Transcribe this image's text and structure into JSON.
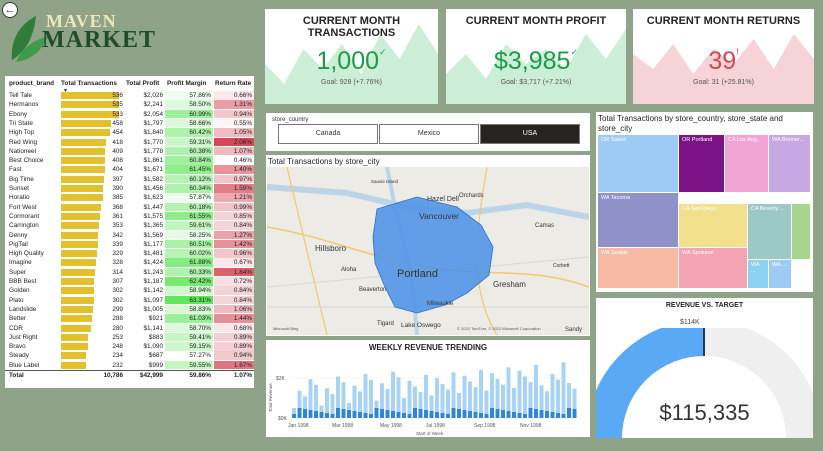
{
  "logo": {
    "line1": "MAVEN",
    "line2": "MARKET"
  },
  "table": {
    "headers": {
      "brand": "product_brand",
      "tx": "Total Transactions",
      "profit": "Total Profit",
      "margin": "Profit Margin",
      "return": "Return Rate"
    },
    "rows": [
      [
        "Tell Tale",
        "536",
        "$2,026",
        "57.86%",
        "0.66%"
      ],
      [
        "Hermanos",
        "535",
        "$2,241",
        "58.50%",
        "1.31%"
      ],
      [
        "Ebony",
        "533",
        "$2,054",
        "60.99%",
        "0.94%"
      ],
      [
        "Tri State",
        "458",
        "$1,797",
        "58.66%",
        "0.55%"
      ],
      [
        "High Top",
        "454",
        "$1,840",
        "60.42%",
        "1.05%"
      ],
      [
        "Red Wing",
        "418",
        "$1,770",
        "59.31%",
        "2.06%"
      ],
      [
        "Nationeel",
        "409",
        "$1,778",
        "60.38%",
        "1.07%"
      ],
      [
        "Best Choice",
        "408",
        "$1,861",
        "60.84%",
        "0.46%"
      ],
      [
        "Fast",
        "404",
        "$1,671",
        "61.45%",
        "1.40%"
      ],
      [
        "Big Time",
        "397",
        "$1,582",
        "60.12%",
        "0.97%"
      ],
      [
        "Sunset",
        "390",
        "$1,456",
        "60.34%",
        "1.59%"
      ],
      [
        "Horatio",
        "385",
        "$1,623",
        "57.87%",
        "1.21%"
      ],
      [
        "Fort West",
        "368",
        "$1,447",
        "60.18%",
        "0.99%"
      ],
      [
        "Cormorant",
        "361",
        "$1,575",
        "61.55%",
        "0.85%"
      ],
      [
        "Carrington",
        "353",
        "$1,365",
        "59.61%",
        "0.84%"
      ],
      [
        "Denny",
        "342",
        "$1,569",
        "58.25%",
        "1.27%"
      ],
      [
        "PigTail",
        "339",
        "$1,177",
        "60.51%",
        "1.42%"
      ],
      [
        "High Quality",
        "329",
        "$1,481",
        "60.02%",
        "0.96%"
      ],
      [
        "Imagine",
        "328",
        "$1,424",
        "61.88%",
        "0.67%"
      ],
      [
        "Super",
        "314",
        "$1,243",
        "60.33%",
        "1.84%"
      ],
      [
        "BBB Best",
        "307",
        "$1,187",
        "62.42%",
        "0.72%"
      ],
      [
        "Golden",
        "302",
        "$1,142",
        "58.94%",
        "0.84%"
      ],
      [
        "Plato",
        "302",
        "$1,097",
        "63.31%",
        "0.84%"
      ],
      [
        "Landslide",
        "299",
        "$1,005",
        "58.83%",
        "1.06%"
      ],
      [
        "Better",
        "288",
        "$921",
        "61.03%",
        "1.44%"
      ],
      [
        "CDR",
        "280",
        "$1,141",
        "58.70%",
        "0.68%"
      ],
      [
        "Just Right",
        "253",
        "$883",
        "59.41%",
        "0.89%"
      ],
      [
        "Bravo",
        "248",
        "$1,090",
        "59.15%",
        "0.89%"
      ],
      [
        "Steady",
        "234",
        "$687",
        "57.27%",
        "0.94%"
      ],
      [
        "Blue Label",
        "232",
        "$999",
        "59.55%",
        "1.67%"
      ]
    ],
    "total": [
      "Total",
      "10,786",
      "$42,999",
      "59.86%",
      "1.07%"
    ]
  },
  "kpis": [
    {
      "title": "CURRENT MONTH TRANSACTIONS",
      "value": "1,000",
      "mark": "✓",
      "goal": "Goal: 928 (+7.76%)",
      "color": "#1a9c47",
      "area": "#cdeed6"
    },
    {
      "title": "CURRENT MONTH PROFIT",
      "value": "$3,985",
      "mark": "✓",
      "goal": "Goal: $3,717 (+7.21%)",
      "color": "#1a9c47",
      "area": "#cdeed6"
    },
    {
      "title": "CURRENT MONTH RETURNS",
      "value": "39",
      "mark": "!",
      "goal": "Goal: 31 (+25.81%)",
      "color": "#d64550",
      "area": "#f5d3d6"
    }
  ],
  "slicer": {
    "title": "store_country",
    "options": [
      "Canada",
      "Mexico",
      "USA"
    ],
    "selected": "USA"
  },
  "map": {
    "title": "Total Transactions by store_city",
    "labels": [
      "Hazel Dell",
      "Orchards",
      "Vancouver",
      "Hillsboro",
      "Aloha",
      "Portland",
      "Gresham",
      "Beaverton",
      "Milwaukie",
      "Tigard",
      "Lake Oswego",
      "Camas",
      "Corbett",
      "Sandy",
      "Sauvie Island"
    ],
    "credit": "© 2022 TomTom, © 2022 Microsoft Corporation",
    "brand": "Microsoft Bing"
  },
  "treemap": {
    "title": "Total Transactions by store_country, store_state and store_city",
    "cells": [
      "OR Salem",
      "OR Portland",
      "CA Los Ang...",
      "WA Bremer...",
      "WA Tacoma",
      "CA San Diego",
      "CA Beverly ...",
      "WA Seattle",
      "WA Spokane",
      "WA ...",
      "WA ..."
    ]
  },
  "weekly": {
    "title": "WEEKLY REVENUE TRENDING",
    "ylabel": "Total Revenue",
    "xlabel": "Start of Week",
    "yticks": [
      "$2K",
      "$0K"
    ],
    "xticks": [
      "Jan 1998",
      "Mar 1998",
      "May 1998",
      "Jul 1998",
      "Sep 1998",
      "Nov 1998"
    ]
  },
  "gauge": {
    "title": "REVENUE VS. TARGET",
    "target_label": "$114K",
    "value_label": "$115,335",
    "fill_fraction": 0.5,
    "color": "#5aa9f5"
  }
}
